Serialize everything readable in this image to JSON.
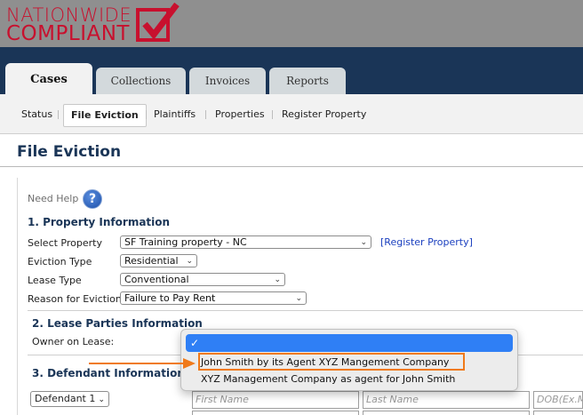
{
  "logo": {
    "line1": "NATIONWIDE",
    "line2": "COMPLIANT",
    "brand_color": "#c8102e",
    "icon": "checkbox-check-icon"
  },
  "tabs": [
    {
      "label": "Cases",
      "active": true
    },
    {
      "label": "Collections",
      "active": false
    },
    {
      "label": "Invoices",
      "active": false
    },
    {
      "label": "Reports",
      "active": false
    }
  ],
  "subnav": [
    "Status",
    "File Eviction",
    "Plaintiffs",
    "Properties",
    "Register Property"
  ],
  "page_title": "File Eviction",
  "need_help": "Need Help",
  "help_icon_glyph": "?",
  "property_info": {
    "heading": "1. Property Information",
    "select_property_label": "Select Property",
    "select_property_value": "SF Training property - NC",
    "register_link": "[Register Property]",
    "eviction_type_label": "Eviction Type",
    "eviction_type_value": "Residential",
    "lease_type_label": "Lease Type",
    "lease_type_value": "Conventional",
    "reason_label": "Reason for Eviction",
    "reason_value": "Failure to Pay Rent"
  },
  "lease_parties": {
    "heading": "2. Lease Parties Information",
    "owner_label": "Owner on Lease:",
    "dropdown_options": [
      "",
      "John Smith by its Agent XYZ Mangement Company",
      "XYZ Management Company as agent for John Smith"
    ],
    "selected_check": "✓",
    "highlight_color": "#f07a1a"
  },
  "defendant": {
    "heading": "3. Defendant Information",
    "select_value": "Defendant 1",
    "first_name_placeholder": "First Name",
    "last_name_placeholder": "Last Name",
    "dob_placeholder": "DOB(Ex.M"
  }
}
